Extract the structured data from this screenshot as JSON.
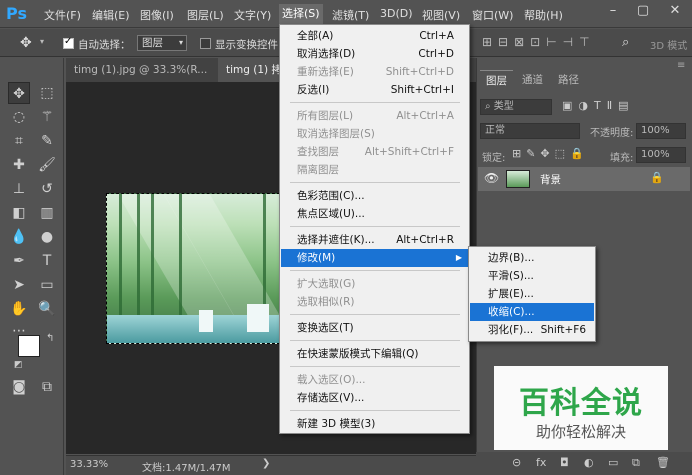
{
  "app": {
    "logo": "Ps"
  },
  "menubar": {
    "items": [
      "文件(F)",
      "编辑(E)",
      "图像(I)",
      "图层(L)",
      "文字(Y)",
      "选择(S)",
      "滤镜(T)",
      "3D(D)",
      "视图(V)",
      "窗口(W)",
      "帮助(H)"
    ],
    "active": "选择(S)",
    "window_controls": [
      "minimize-icon",
      "maximize-icon",
      "close-icon"
    ]
  },
  "options_bar": {
    "auto_select_label": "自动选择：",
    "auto_select_value": "图层",
    "show_transform_label": "显示变换控件",
    "mode_3d": "3D 模式"
  },
  "doc_tabs": [
    {
      "label": "timg (1).jpg @ 33.3%(R..."
    },
    {
      "label": "timg (1) 拷"
    }
  ],
  "select_menu": [
    {
      "label": "全部(A)",
      "shortcut": "Ctrl+A",
      "enabled": true
    },
    {
      "label": "取消选择(D)",
      "shortcut": "Ctrl+D",
      "enabled": true
    },
    {
      "label": "重新选择(E)",
      "shortcut": "Shift+Ctrl+D",
      "enabled": false
    },
    {
      "label": "反选(I)",
      "shortcut": "Shift+Ctrl+I",
      "enabled": true
    },
    {
      "label": "所有图层(L)",
      "shortcut": "Alt+Ctrl+A",
      "enabled": false
    },
    {
      "label": "取消选择图层(S)",
      "shortcut": "",
      "enabled": false
    },
    {
      "label": "查找图层",
      "shortcut": "Alt+Shift+Ctrl+F",
      "enabled": false
    },
    {
      "label": "隔离图层",
      "shortcut": "",
      "enabled": false
    },
    {
      "label": "色彩范围(C)...",
      "shortcut": "",
      "enabled": true
    },
    {
      "label": "焦点区域(U)...",
      "shortcut": "",
      "enabled": true
    },
    {
      "label": "选择并遮住(K)...",
      "shortcut": "Alt+Ctrl+R",
      "enabled": true
    },
    {
      "label": "修改(M)",
      "shortcut": "",
      "enabled": true
    },
    {
      "label": "扩大选取(G)",
      "shortcut": "",
      "enabled": false
    },
    {
      "label": "选取相似(R)",
      "shortcut": "",
      "enabled": false
    },
    {
      "label": "变换选区(T)",
      "shortcut": "",
      "enabled": true
    },
    {
      "label": "在快速蒙版模式下编辑(Q)",
      "shortcut": "",
      "enabled": true
    },
    {
      "label": "载入选区(O)...",
      "shortcut": "",
      "enabled": false
    },
    {
      "label": "存储选区(V)...",
      "shortcut": "",
      "enabled": true
    },
    {
      "label": "新建 3D 模型(3)",
      "shortcut": "",
      "enabled": true
    }
  ],
  "modify_submenu": [
    {
      "label": "边界(B)...",
      "shortcut": ""
    },
    {
      "label": "平滑(S)...",
      "shortcut": ""
    },
    {
      "label": "扩展(E)...",
      "shortcut": ""
    },
    {
      "label": "收缩(C)...",
      "shortcut": ""
    },
    {
      "label": "羽化(F)...",
      "shortcut": "Shift+F6"
    }
  ],
  "layers_panel": {
    "tabs": [
      "图层",
      "通道",
      "路径"
    ],
    "filter_label": "类型",
    "blend_mode": "正常",
    "opacity_label": "不透明度:",
    "opacity_value": "100%",
    "lock_label": "锁定:",
    "fill_label": "填充:",
    "fill_value": "100%",
    "layer_name": "背景"
  },
  "status_bar": {
    "zoom": "33.33%",
    "doc_info": "文档:1.47M/1.47M"
  },
  "watermark": {
    "title": "百科全说",
    "subtitle": "助你轻松解决"
  },
  "colors": {
    "accent": "#1a73d4",
    "app_bg": "#535353",
    "watermark_green": "#2ea64a"
  }
}
